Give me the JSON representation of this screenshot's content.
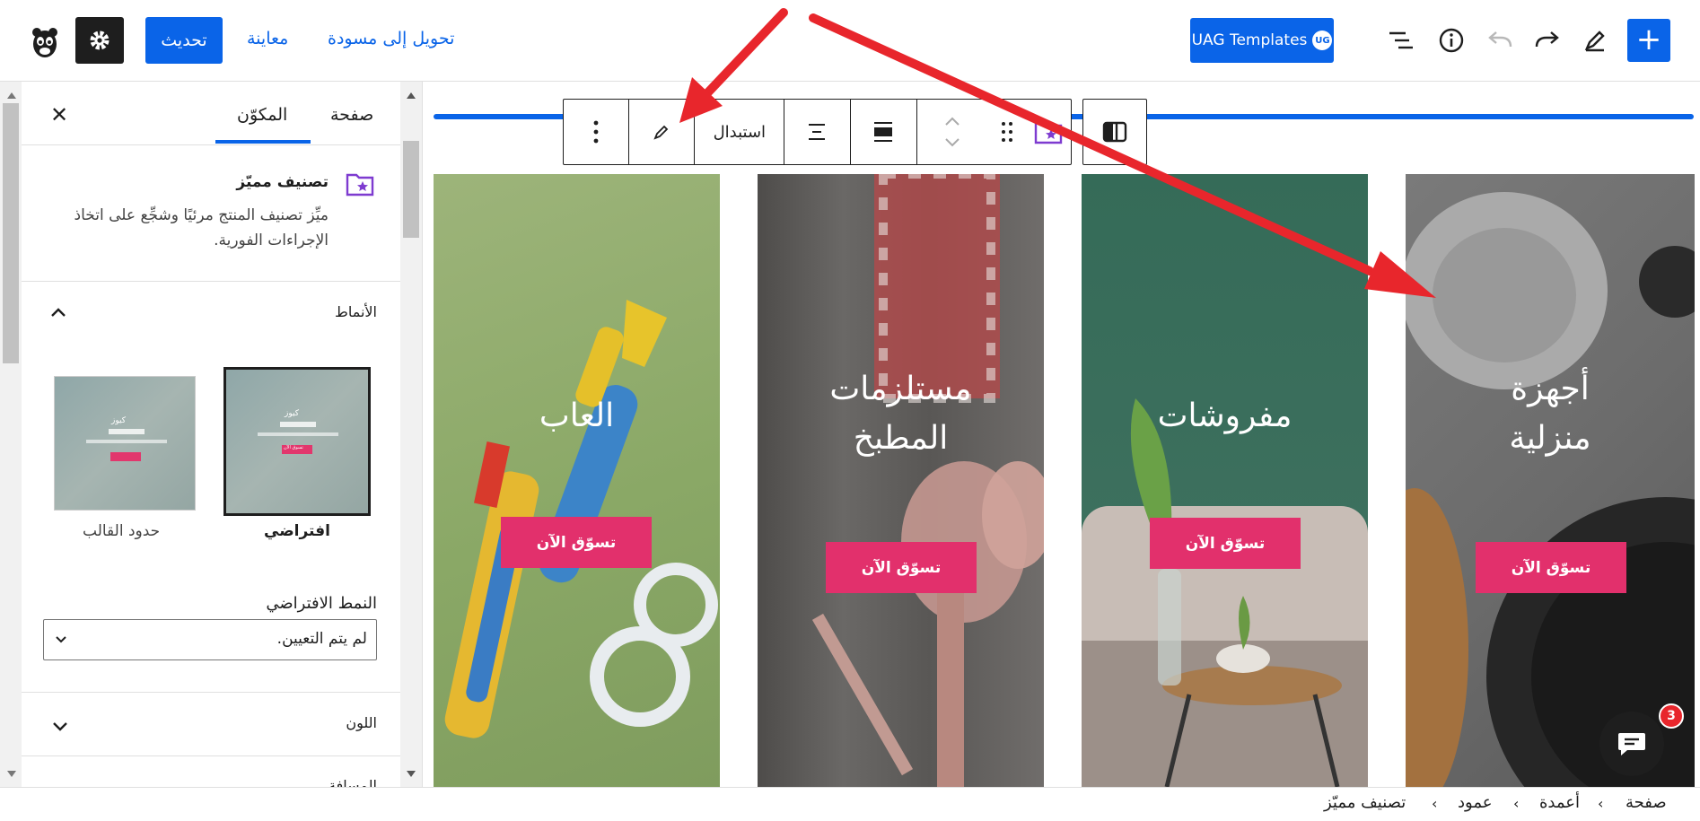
{
  "header": {
    "uag_label": "UAG Templates",
    "uag_badge": "UG",
    "draft_link": "تحويل إلى مسودة",
    "preview_link": "معاينة",
    "update_label": "تحديث"
  },
  "sidebar": {
    "tab_page": "صفحة",
    "tab_block": "المكوّن",
    "block_title": "تصنيف مميّز",
    "block_desc_line1": "ميِّز تصنيف المنتج مرئيًا وشجِّع على اتخاذ",
    "block_desc_line2": "الإجراءات الفورية.",
    "styles_heading": "الأنماط",
    "style_default": "افتراضي",
    "style_borders": "حدود القالب",
    "mock_brand": "كيوز",
    "mock_button": "تسوق الآن",
    "default_style_label": "النمط الافتراضي",
    "default_style_value": "لم يتم التعيين.",
    "color_panel": "اللون",
    "next_panel": "المسافة"
  },
  "toolbar": {
    "replace_label": "استبدال"
  },
  "cards": [
    {
      "title_line1": "العاب",
      "title_line2": "",
      "button": "تسوّق الآن",
      "bg": "#8eab6a"
    },
    {
      "title_line1": "مستلزمات",
      "title_line2": "المطبخ",
      "button": "تسوّق الآن",
      "bg": "#5d5a58"
    },
    {
      "title_line1": "مفروشات",
      "title_line2": "",
      "button": "تسوّق الآن",
      "bg": "#3b6e5b"
    },
    {
      "title_line1": "أجهزة",
      "title_line2": "منزلية",
      "button": "تسوّق الآن",
      "bg": "#6b6b6b"
    }
  ],
  "breadcrumb": {
    "items": [
      "صفحة",
      "أعمدة",
      "عمود",
      "تصنيف مميّز"
    ]
  },
  "chat": {
    "badge_count": "3"
  },
  "colors": {
    "accent": "#0a64e8",
    "shop_button": "#e2306c",
    "annotation_arrow": "#e8262c"
  }
}
